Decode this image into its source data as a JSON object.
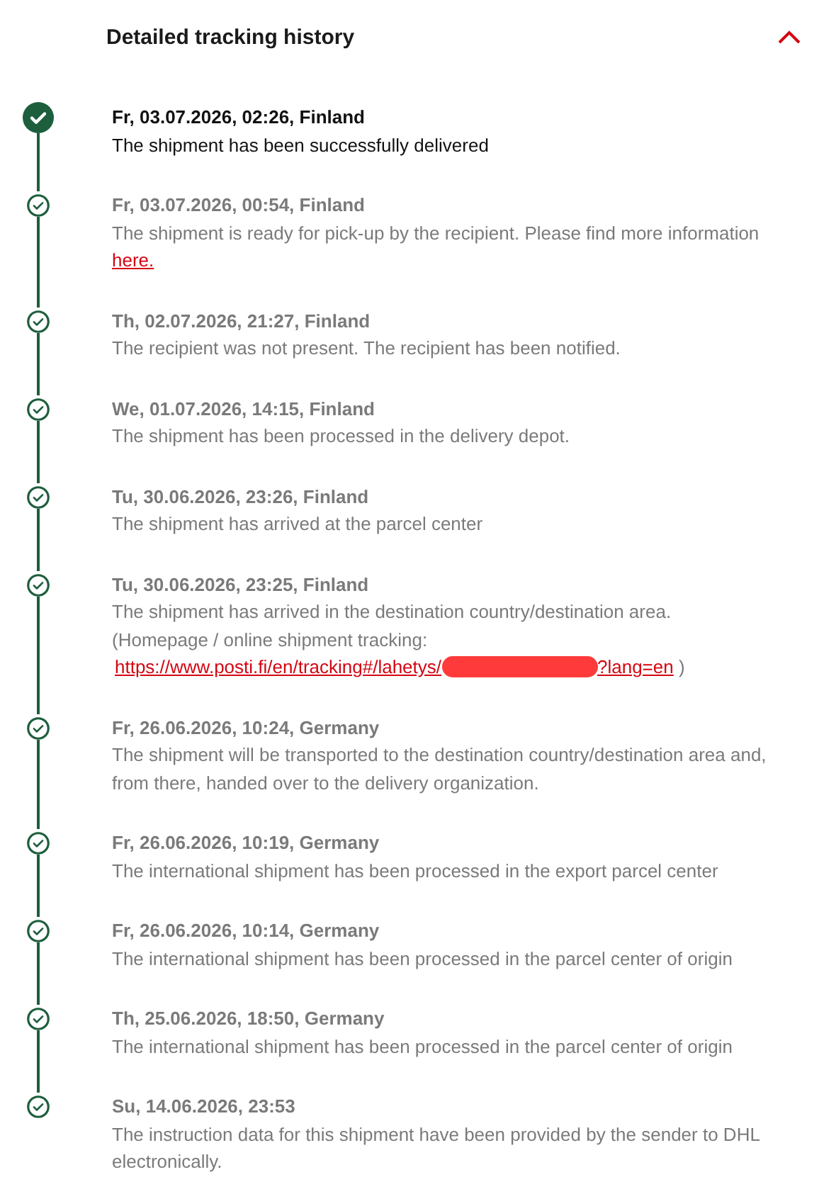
{
  "title": "Detailed tracking history",
  "expanded": true,
  "events": [
    {
      "kind": "plain",
      "current": true,
      "date": "Fr, 03.07.2026, 02:26, Finland",
      "text": "The shipment has been successfully delivered"
    },
    {
      "kind": "link",
      "current": false,
      "date": "Fr, 03.07.2026, 00:54, Finland",
      "text": "The shipment is ready for pick-up by the recipient. Please find more information",
      "link": "here."
    },
    {
      "kind": "plain",
      "current": false,
      "date": "Th, 02.07.2026, 21:27, Finland",
      "text": "The recipient was not present. The recipient has been notified."
    },
    {
      "kind": "plain",
      "current": false,
      "date": "We, 01.07.2026, 14:15, Finland",
      "text": "The shipment has been processed in the delivery depot."
    },
    {
      "kind": "plain",
      "current": false,
      "date": "Tu, 30.06.2026, 23:26, Finland",
      "text": "The shipment has arrived at the parcel center"
    },
    {
      "kind": "url",
      "current": false,
      "date": "Tu, 30.06.2026, 23:25, Finland",
      "text": "The shipment has arrived in the destination country/destination area.",
      "note": "(Homepage / online shipment tracking:",
      "url_start": "https://www.posti.fi/en/tracking#/lahetys/",
      "url_end": "?lang=en",
      "closing": ")"
    },
    {
      "kind": "plain",
      "current": false,
      "date": "Fr, 26.06.2026, 10:24, Germany",
      "text": "The shipment will be transported to the destination country/destination area and, from there, handed over to the delivery organization."
    },
    {
      "kind": "plain",
      "current": false,
      "date": "Fr, 26.06.2026, 10:19, Germany",
      "text": "The international shipment has been processed in the export parcel center"
    },
    {
      "kind": "plain",
      "current": false,
      "date": "Fr, 26.06.2026, 10:14, Germany",
      "text": "The international shipment has been processed in the parcel center of origin"
    },
    {
      "kind": "plain",
      "current": false,
      "date": "Th, 25.06.2026, 18:50, Germany",
      "text": "The international shipment has been processed in the parcel center of origin"
    },
    {
      "kind": "plain",
      "current": false,
      "date": "Su, 14.06.2026, 23:53",
      "text": "The instruction data for this shipment have been provided by the sender to DHL electronically."
    }
  ]
}
